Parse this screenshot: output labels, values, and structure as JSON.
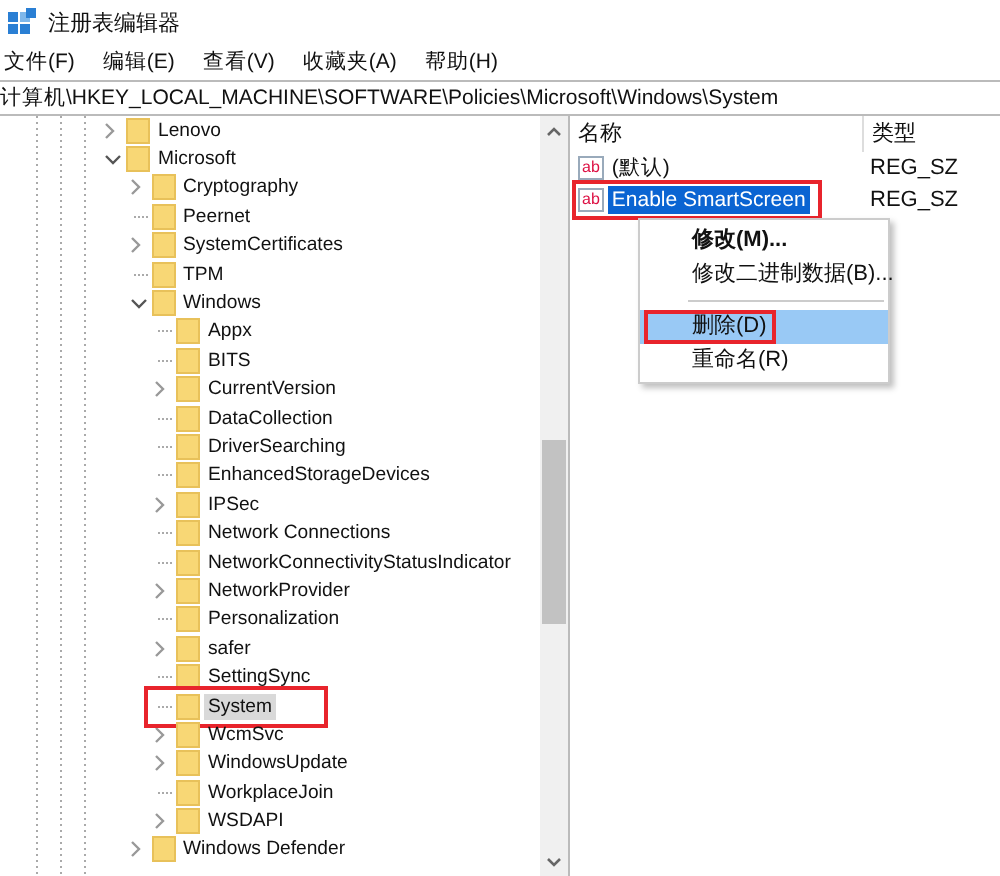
{
  "window": {
    "title": "注册表编辑器"
  },
  "menu_bar": [
    "文件(F)",
    "编辑(E)",
    "查看(V)",
    "收藏夹(A)",
    "帮助(H)"
  ],
  "address": "计算机\\HKEY_LOCAL_MACHINE\\SOFTWARE\\Policies\\Microsoft\\Windows\\System",
  "tree": [
    {
      "label": "Lenovo",
      "expanded": false,
      "selected": false
    },
    {
      "label": "Microsoft",
      "expanded": true,
      "selected": false,
      "children": [
        {
          "label": "Cryptography",
          "expanded": false,
          "selected": false
        },
        {
          "label": "Peernet",
          "selected": false
        },
        {
          "label": "SystemCertificates",
          "expanded": false,
          "selected": false
        },
        {
          "label": "TPM",
          "selected": false
        },
        {
          "label": "Windows",
          "expanded": true,
          "selected": false,
          "children": [
            {
              "label": "Appx",
              "selected": false
            },
            {
              "label": "BITS",
              "selected": false
            },
            {
              "label": "CurrentVersion",
              "expanded": false,
              "selected": false
            },
            {
              "label": "DataCollection",
              "selected": false
            },
            {
              "label": "DriverSearching",
              "selected": false
            },
            {
              "label": "EnhancedStorageDevices",
              "selected": false
            },
            {
              "label": "IPSec",
              "expanded": false,
              "selected": false
            },
            {
              "label": "Network Connections",
              "selected": false
            },
            {
              "label": "NetworkConnectivityStatusIndicator",
              "selected": false
            },
            {
              "label": "NetworkProvider",
              "expanded": false,
              "selected": false
            },
            {
              "label": "Personalization",
              "selected": false
            },
            {
              "label": "safer",
              "expanded": false,
              "selected": false
            },
            {
              "label": "SettingSync",
              "selected": false
            },
            {
              "label": "System",
              "selected": true,
              "marked": true
            },
            {
              "label": "WcmSvc",
              "expanded": false,
              "selected": false
            },
            {
              "label": "WindowsUpdate",
              "expanded": false,
              "selected": false
            },
            {
              "label": "WorkplaceJoin",
              "selected": false
            },
            {
              "label": "WSDAPI",
              "expanded": false,
              "selected": false
            }
          ]
        },
        {
          "label": "Windows Defender",
          "expanded": false,
          "selected": false
        }
      ]
    }
  ],
  "values": {
    "columns": [
      "名称",
      "类型"
    ],
    "rows": [
      {
        "icon": "ab",
        "name": "(默认)",
        "type": "REG_SZ",
        "selected": false
      },
      {
        "icon": "ab",
        "name": "Enable SmartScreen",
        "type": "REG_SZ",
        "selected": true,
        "marked": true
      }
    ]
  },
  "context_menu": [
    {
      "kind": "item",
      "label": "修改(M)...",
      "default": true,
      "selected": false
    },
    {
      "kind": "item",
      "label": "修改二进制数据(B)...",
      "default": false,
      "selected": false
    },
    {
      "kind": "separator"
    },
    {
      "kind": "item",
      "label": "删除(D)",
      "default": false,
      "selected": true,
      "marked": true
    },
    {
      "kind": "item",
      "label": "重命名(R)",
      "default": false,
      "selected": false
    }
  ]
}
